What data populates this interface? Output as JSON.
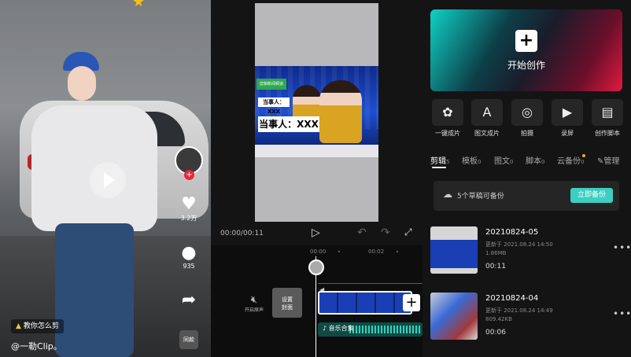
{
  "panel1": {
    "likes": "3.2万",
    "comments": "935",
    "tag": "教你怎么剪",
    "author": "@一勒Clip。",
    "music_label": "同款"
  },
  "panel2": {
    "preview": {
      "small_name": "当事人：XXX",
      "big_name": "当事人：XXX",
      "green_box": "剪辑新闻频道"
    },
    "timecode": "00:00/00:11",
    "ruler": [
      "00:00",
      "00:02"
    ],
    "mute_label": "开启原声",
    "cover_label": "设置\n封面",
    "music_track_label": "音乐合集"
  },
  "panel3": {
    "create_label": "开始创作",
    "tools": [
      {
        "icon": "cut-icon",
        "label": "一键成片"
      },
      {
        "icon": "image-text-icon",
        "label": "图文成片"
      },
      {
        "icon": "camera-icon",
        "label": "拍摄"
      },
      {
        "icon": "screen-record-icon",
        "label": "录屏"
      },
      {
        "icon": "script-icon",
        "label": "创作脚本"
      }
    ],
    "tabs": [
      {
        "label": "剪辑",
        "count": "5"
      },
      {
        "label": "模板",
        "count": "0"
      },
      {
        "label": "图文",
        "count": "0"
      },
      {
        "label": "脚本",
        "count": "0"
      },
      {
        "label": "云备份",
        "count": "0"
      },
      {
        "label": "管理",
        "count": ""
      }
    ],
    "backup_text": "5个草稿可备份",
    "backup_button": "立即备份",
    "drafts": [
      {
        "title": "20210824-05",
        "updated": "更新于 2021.08.24 14:50",
        "size": "1.86MB",
        "duration": "00:11"
      },
      {
        "title": "20210824-04",
        "updated": "更新于 2021.08.24 14:49",
        "size": "809.42KB",
        "duration": "00:06"
      }
    ]
  }
}
